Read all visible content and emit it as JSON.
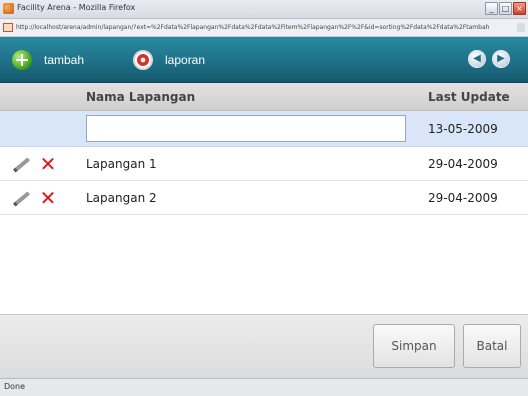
{
  "window": {
    "title": "Facility Arena - Mozilla Firefox",
    "url": "http://localhost/arena/admin/lapangan/?ext=%2Fdata%2Flapangan%2Fdata%2Fdata%2Fitem%2Flapangan%2F%2F&id=sorting%2Fdata%2Fdata%2Ftambah",
    "controls": {
      "minimize": "_",
      "maximize": "□",
      "close": "×"
    }
  },
  "toolbar": {
    "add_label": "tambah",
    "report_label": "laporan",
    "prev_symbol": "◀",
    "next_symbol": "▶"
  },
  "grid": {
    "columns": {
      "name": "Nama Lapangan",
      "updated": "Last Update"
    },
    "new_row": {
      "name_value": "",
      "date": "13-05-2009"
    },
    "rows": [
      {
        "name": "Lapangan 1",
        "date": "29-04-2009"
      },
      {
        "name": "Lapangan 2",
        "date": "29-04-2009"
      }
    ]
  },
  "footer": {
    "save_label": "Simpan",
    "cancel_label": "Batal"
  },
  "status": {
    "text": "Done"
  },
  "colors": {
    "toolbar": "#1e7188",
    "selected_row": "#d9e5f8",
    "delete": "#d8191f"
  }
}
